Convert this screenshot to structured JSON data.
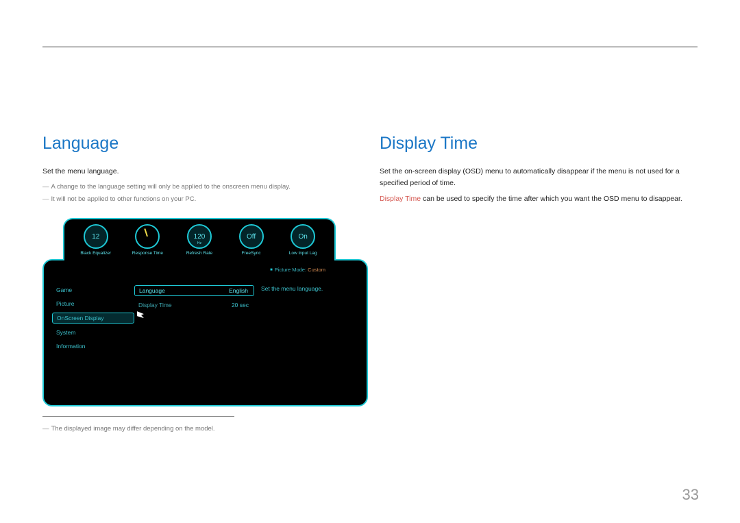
{
  "page_number": "33",
  "left": {
    "heading": "Language",
    "intro": "Set the menu language.",
    "note1": "A change to the language setting will only be applied to the onscreen menu display.",
    "note2": "It will not be applied to other functions on your PC.",
    "footnote": "The displayed image may differ depending on the model."
  },
  "right": {
    "heading": "Display Time",
    "intro": "Set the on-screen display (OSD) menu to automatically disappear if the menu is not used for a specified period of time.",
    "highlight": "Display Time",
    "rest": " can be used to specify the time after which you want the OSD menu to disappear."
  },
  "osd": {
    "dials": {
      "black_eq": {
        "value": "12",
        "label": "Black Equalizer"
      },
      "response_time": {
        "label": "Response Time"
      },
      "refresh_rate": {
        "value": "120",
        "sub": "Hz",
        "label": "Refresh Rate"
      },
      "freesync": {
        "value": "Off",
        "label": "FreeSync"
      },
      "low_input_lag": {
        "value": "On",
        "label": "Low Input Lag"
      }
    },
    "picture_mode_label": "Picture Mode:",
    "picture_mode_value": "Custom",
    "side_menu": [
      "Game",
      "Picture",
      "OnScreen Display",
      "System",
      "Information"
    ],
    "selected_side_index": 2,
    "sub_menu": [
      {
        "label": "Language",
        "value": "English"
      },
      {
        "label": "Display Time",
        "value": "20 sec"
      }
    ],
    "selected_sub_index": 0,
    "description": "Set the menu language."
  }
}
